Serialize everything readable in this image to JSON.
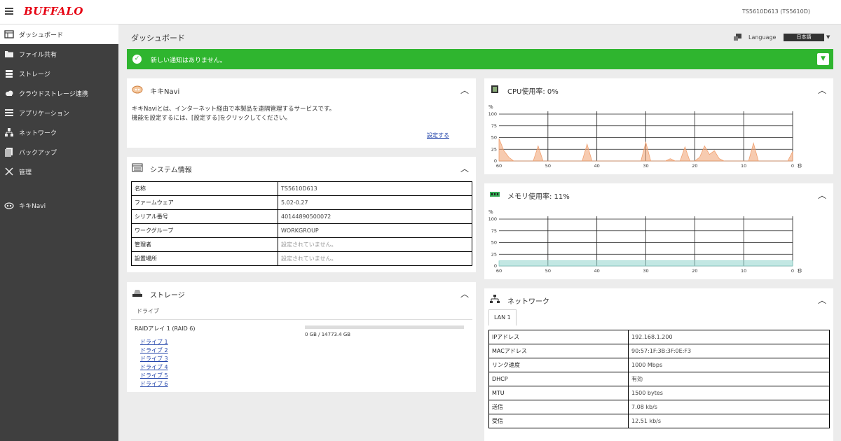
{
  "header": {
    "logo": "BUFFALO",
    "device": "TS5610D613 (TS5610D)"
  },
  "sidebar": {
    "items": [
      {
        "label": "ダッシュボード",
        "icon": "dashboard-icon",
        "active": true
      },
      {
        "label": "ファイル共有",
        "icon": "folder-icon"
      },
      {
        "label": "ストレージ",
        "icon": "storage-icon"
      },
      {
        "label": "クラウドストレージ連携",
        "icon": "cloud-icon"
      },
      {
        "label": "アプリケーション",
        "icon": "apps-icon"
      },
      {
        "label": "ネットワーク",
        "icon": "network-icon"
      },
      {
        "label": "バックアップ",
        "icon": "backup-icon"
      },
      {
        "label": "管理",
        "icon": "tools-icon"
      },
      {
        "label": "キキNavi",
        "icon": "kikinavi-icon"
      }
    ]
  },
  "page": {
    "title": "ダッシュボード"
  },
  "language": {
    "label": "Language",
    "selected": "日本語"
  },
  "notification": {
    "message": "新しい通知はありません。"
  },
  "kikinavi": {
    "title": "キキNavi",
    "line1": "キキNaviとは、インターネット経由で本製品を遠隔管理するサービスです。",
    "line2": "機能を設定するには、[設定する]をクリックしてください。",
    "link": "設定する"
  },
  "system_info": {
    "title": "システム情報",
    "rows": [
      {
        "key": "名称",
        "value": "TS5610D613",
        "muted": false
      },
      {
        "key": "ファームウェア",
        "value": "5.02-0.27",
        "muted": false
      },
      {
        "key": "シリアル番号",
        "value": "40144890500072",
        "muted": false
      },
      {
        "key": "ワークグループ",
        "value": "WORKGROUP",
        "muted": false
      },
      {
        "key": "管理者",
        "value": "設定されていません。",
        "muted": true
      },
      {
        "key": "設置場所",
        "value": "設定されていません。",
        "muted": true
      }
    ]
  },
  "storage": {
    "title": "ストレージ",
    "tab": "ドライブ",
    "raid_label": "RAIDアレイ 1 (RAID 6)",
    "usage_text": "0 GB / 14773.4 GB",
    "usage_fraction": 0.0,
    "drives": [
      "ドライブ 1",
      "ドライブ 2",
      "ドライブ 3",
      "ドライブ 4",
      "ドライブ 5",
      "ドライブ 6"
    ]
  },
  "network": {
    "title": "ネットワーク",
    "tab": "LAN 1",
    "rows": [
      {
        "key": "IPアドレス",
        "value": "192.168.1.200"
      },
      {
        "key": "MACアドレス",
        "value": "90:57:1F:3B:3F:0E:F3"
      },
      {
        "key": "リンク速度",
        "value": "1000 Mbps"
      },
      {
        "key": "DHCP",
        "value": "有効"
      },
      {
        "key": "MTU",
        "value": "1500 bytes"
      },
      {
        "key": "送信",
        "value": "7.08 kb/s"
      },
      {
        "key": "受信",
        "value": "12.51 kb/s"
      }
    ]
  },
  "chart_data": [
    {
      "type": "area",
      "title": "CPU使用率: 0%",
      "ylabel": "%",
      "xlabel": "秒",
      "ylim": [
        0,
        100
      ],
      "xlim": [
        60,
        0
      ],
      "y_ticks": [
        "100",
        "75",
        "50",
        "25",
        "0"
      ],
      "x_ticks": [
        "60",
        "50",
        "40",
        "30",
        "20",
        "10",
        "0"
      ],
      "color": "#f0a070",
      "x": [
        60,
        59,
        58,
        57,
        56,
        55,
        54,
        53,
        52,
        51,
        50,
        49,
        48,
        47,
        46,
        45,
        44,
        43,
        42,
        41,
        40,
        39,
        38,
        37,
        36,
        35,
        34,
        33,
        32,
        31,
        30,
        29,
        28,
        27,
        26,
        25,
        24,
        23,
        22,
        21,
        20,
        19,
        18,
        17,
        16,
        15,
        14,
        13,
        12,
        11,
        10,
        9,
        8,
        7,
        6,
        5,
        4,
        3,
        2,
        1,
        0
      ],
      "values": [
        48,
        22,
        8,
        0,
        0,
        0,
        0,
        0,
        32,
        0,
        0,
        0,
        0,
        0,
        0,
        0,
        0,
        0,
        36,
        0,
        0,
        0,
        0,
        0,
        0,
        0,
        0,
        0,
        0,
        0,
        40,
        0,
        0,
        0,
        0,
        5,
        0,
        0,
        30,
        0,
        0,
        8,
        32,
        14,
        22,
        5,
        0,
        0,
        0,
        0,
        0,
        0,
        38,
        0,
        0,
        0,
        0,
        0,
        0,
        0,
        20
      ]
    },
    {
      "type": "area",
      "title": "メモリ使用率: 11%",
      "ylabel": "%",
      "xlabel": "秒",
      "ylim": [
        0,
        100
      ],
      "xlim": [
        60,
        0
      ],
      "y_ticks": [
        "100",
        "75",
        "50",
        "25",
        "0"
      ],
      "x_ticks": [
        "60",
        "50",
        "40",
        "30",
        "20",
        "10",
        "0"
      ],
      "color": "#8fd4cc",
      "x": [
        60,
        0
      ],
      "values": [
        11,
        11
      ]
    }
  ]
}
